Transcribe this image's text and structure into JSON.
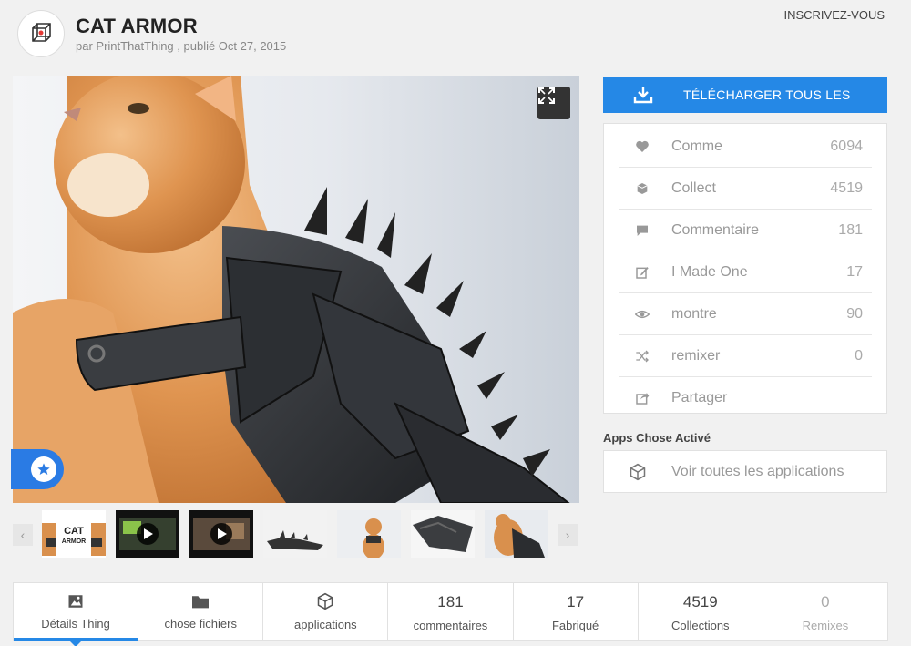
{
  "header": {
    "title": "CAT ARMOR",
    "byline": "par PrintThatThing , publié Oct 27, 2015",
    "signup": "INSCRIVEZ-VOUS"
  },
  "thumbnails": {
    "cat_text": "CAT",
    "armor_text": "ARMOR"
  },
  "download": {
    "label": "TÉLÉCHARGER TOUS LES"
  },
  "stats": [
    {
      "icon": "heart-icon",
      "label": "Comme",
      "count": "6094"
    },
    {
      "icon": "collect-icon",
      "label": "Collect",
      "count": "4519"
    },
    {
      "icon": "comment-icon",
      "label": "Commentaire",
      "count": "181"
    },
    {
      "icon": "edit-icon",
      "label": "I Made One",
      "count": "17"
    },
    {
      "icon": "eye-icon",
      "label": "montre",
      "count": "90"
    },
    {
      "icon": "shuffle-icon",
      "label": "remixer",
      "count": "0"
    },
    {
      "icon": "share-icon",
      "label": "Partager",
      "count": ""
    }
  ],
  "apps": {
    "title": "Apps Chose Activé",
    "button_label": "Voir toutes les applications"
  },
  "tabs": [
    {
      "number": "",
      "label": "Détails Thing"
    },
    {
      "number": "",
      "label": "chose fichiers"
    },
    {
      "number": "",
      "label": "applications"
    },
    {
      "number": "181",
      "label": "commentaires"
    },
    {
      "number": "17",
      "label": "Fabriqué"
    },
    {
      "number": "4519",
      "label": "Collections"
    },
    {
      "number": "0",
      "label": "Remixes"
    }
  ],
  "colors": {
    "accent": "#2588e6",
    "fav_blue": "#2a7be4"
  }
}
